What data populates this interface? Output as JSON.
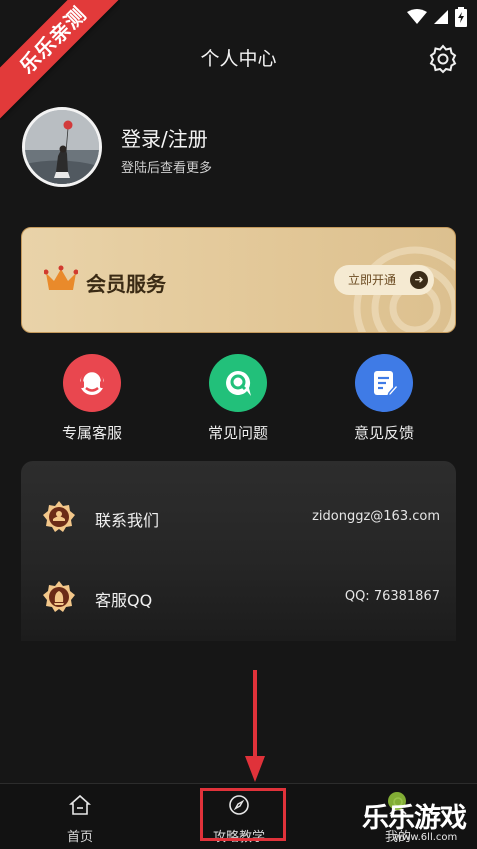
{
  "ribbon": {
    "text": "乐乐亲测"
  },
  "header": {
    "title": "个人中心",
    "settings_icon": "gear-icon"
  },
  "profile": {
    "login_label": "登录/注册",
    "subtitle": "登陆后查看更多"
  },
  "vip": {
    "title": "会员服务",
    "button_label": "立即开通",
    "button_arrow": "➜"
  },
  "quick_actions": [
    {
      "label": "专属客服",
      "icon": "headset-icon",
      "color": "#e9474f"
    },
    {
      "label": "常见问题",
      "icon": "question-chat-icon",
      "color": "#22c07a"
    },
    {
      "label": "意见反馈",
      "icon": "feedback-icon",
      "color": "#3f7be6"
    }
  ],
  "contact": {
    "rows": [
      {
        "label": "联系我们",
        "value": "zidonggz@163.com",
        "icon": "contact-badge-icon"
      },
      {
        "label": "客服QQ",
        "value": "QQ: 76381867",
        "icon": "qq-badge-icon"
      }
    ]
  },
  "nav": {
    "items": [
      {
        "label": "首页",
        "icon": "home-icon"
      },
      {
        "label": "攻略教学",
        "icon": "compass-icon"
      },
      {
        "label": "我的",
        "icon": "profile-icon"
      }
    ]
  },
  "watermark": {
    "main": "乐乐游戏",
    "url": "www.6ll.com"
  },
  "colors": {
    "accent_red": "#e0323a",
    "vip_gold": "#e2c797",
    "background": "#161616"
  }
}
